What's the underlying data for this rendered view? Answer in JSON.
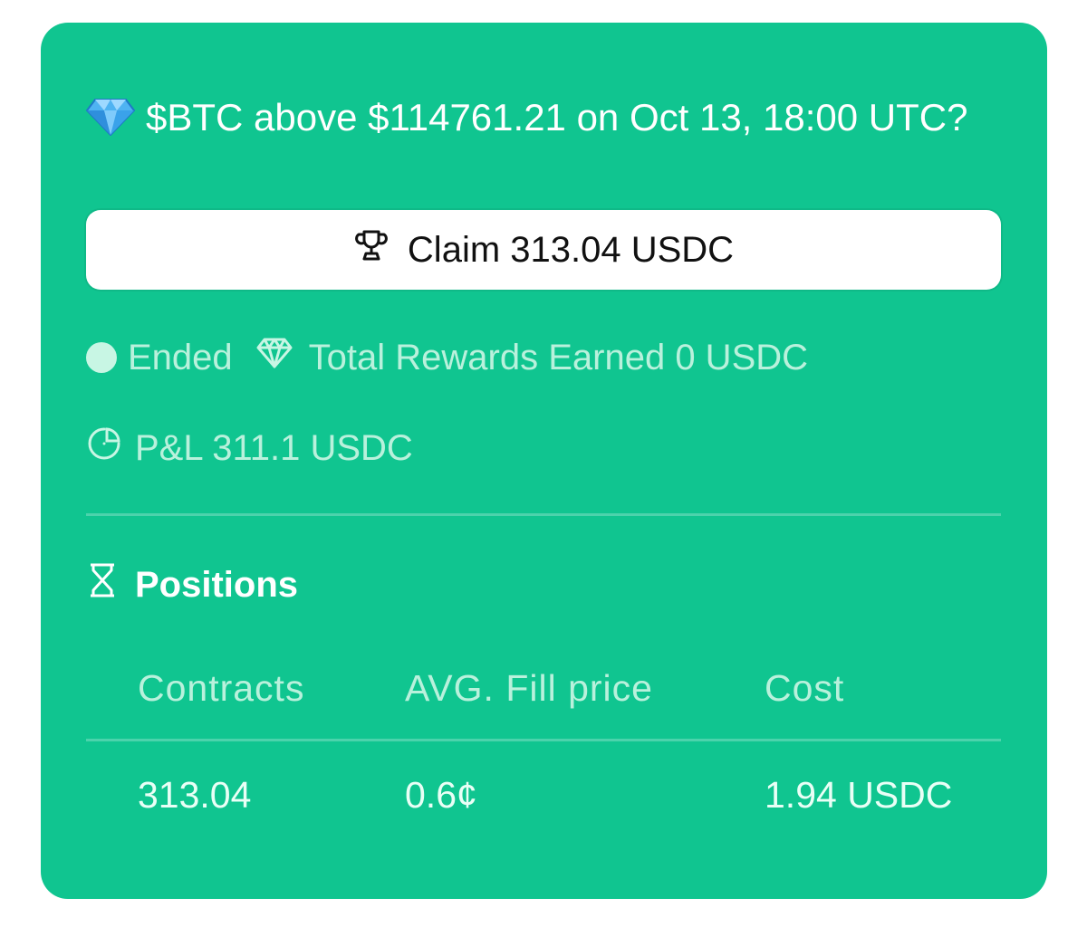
{
  "market": {
    "title": "$BTC above $114761.21 on Oct 13, 18:00 UTC?",
    "icon": "gem-icon"
  },
  "claim": {
    "label": "Claim 313.04 USDC",
    "icon": "trophy-icon"
  },
  "status": {
    "label": "Ended",
    "rewards_label": "Total Rewards Earned 0 USDC",
    "pnl_label": "P&L 311.1 USDC"
  },
  "positions": {
    "title": "Positions",
    "icon": "hourglass-icon",
    "columns": [
      "Contracts",
      "AVG. Fill price",
      "Cost"
    ],
    "rows": [
      [
        "313.04",
        "0.6¢",
        "1.94 USDC"
      ]
    ]
  },
  "colors": {
    "card_bg": "#10c590",
    "muted_text": "#b9f1dc",
    "button_bg": "#ffffff"
  }
}
